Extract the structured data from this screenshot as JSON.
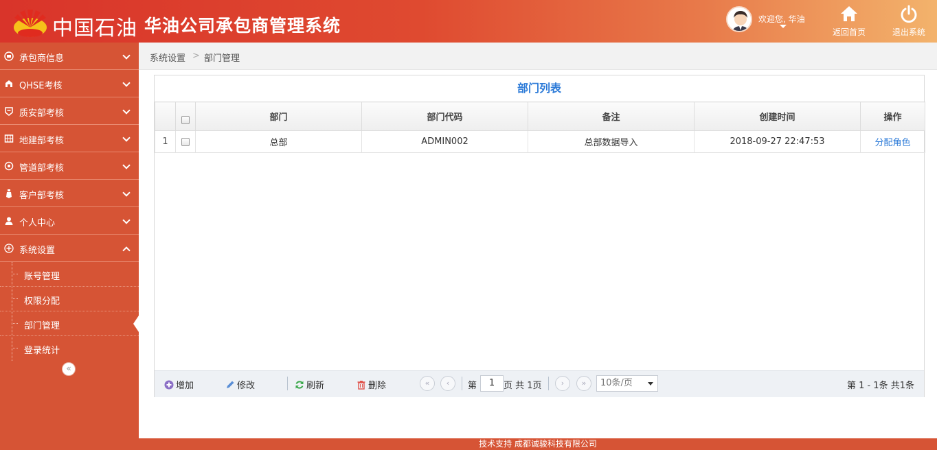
{
  "header": {
    "brand": "中国石油",
    "system_title": "华油公司承包商管理系统",
    "welcome": "欢迎您, 华油",
    "home_label": "返回首页",
    "logout_label": "退出系统"
  },
  "sidebar": {
    "items": [
      {
        "label": "承包商信息",
        "icon": "contractor-info-icon",
        "expanded": false
      },
      {
        "label": "QHSE考核",
        "icon": "qhse-icon",
        "expanded": false
      },
      {
        "label": "质安部考核",
        "icon": "quality-safety-icon",
        "expanded": false
      },
      {
        "label": "地建部考核",
        "icon": "construction-icon",
        "expanded": false
      },
      {
        "label": "管道部考核",
        "icon": "pipeline-icon",
        "expanded": false
      },
      {
        "label": "客户部考核",
        "icon": "customer-icon",
        "expanded": false
      },
      {
        "label": "个人中心",
        "icon": "user-icon",
        "expanded": false
      },
      {
        "label": "系统设置",
        "icon": "settings-icon",
        "expanded": true
      }
    ],
    "subitems": [
      {
        "label": "账号管理"
      },
      {
        "label": "权限分配"
      },
      {
        "label": "部门管理",
        "active": true
      },
      {
        "label": "登录统计"
      }
    ],
    "collapse_glyph": "«"
  },
  "breadcrumb": {
    "level1": "系统设置",
    "separator": ">",
    "level2": "部门管理"
  },
  "panel": {
    "title": "部门列表",
    "columns": [
      "部门",
      "部门代码",
      "备注",
      "创建时间",
      "操作"
    ],
    "rows": [
      {
        "index": "1",
        "dept": "总部",
        "code": "ADMIN002",
        "remark": "总部数据导入",
        "created": "2018-09-27 22:47:53",
        "action": "分配角色"
      }
    ]
  },
  "toolbar": {
    "add": "增加",
    "edit": "修改",
    "refresh": "刷新",
    "delete": "删除",
    "page_prefix": "第",
    "page_value": "1",
    "page_suffix": "页 共 1页",
    "page_size": "10条/页",
    "info": "第 1 - 1条 共1条",
    "first_glyph": "«",
    "prev_glyph": "‹",
    "next_glyph": "›",
    "last_glyph": "»"
  },
  "footer": {
    "text": "技术支持 成都诚骏科技有限公司"
  },
  "colors": {
    "sidebar": "#d65435",
    "header_start": "#d9342a",
    "header_end": "#f3b36c",
    "link": "#2d7bd8"
  }
}
